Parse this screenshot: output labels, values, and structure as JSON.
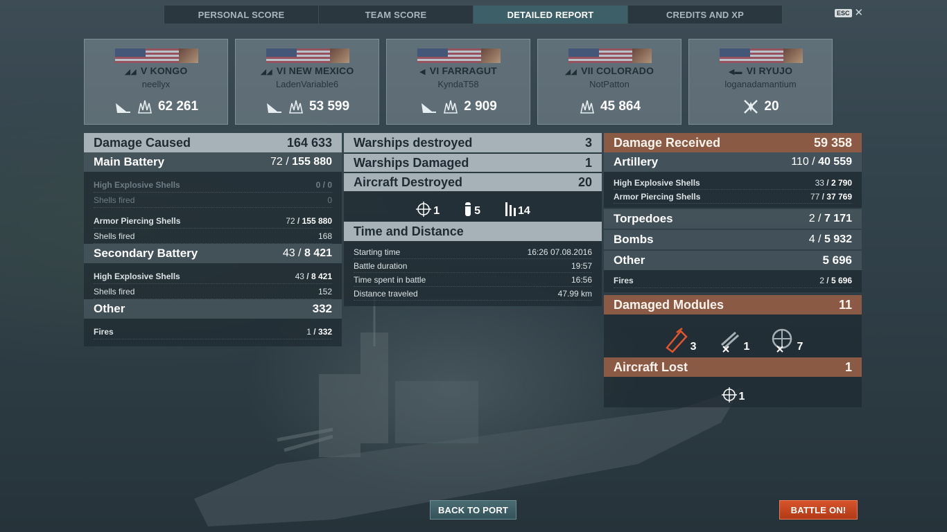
{
  "tabs": [
    "PERSONAL SCORE",
    "TEAM SCORE",
    "DETAILED REPORT",
    "CREDITS AND XP"
  ],
  "active_tab": "DETAILED REPORT",
  "esc_label": "ESC",
  "players": [
    {
      "tier": "V",
      "ship": "KONGO",
      "player": "neellyx",
      "score": "62 261",
      "icons": [
        "torpedo-hit-icon",
        "damage-burst-icon"
      ]
    },
    {
      "tier": "VI",
      "ship": "NEW MEXICO",
      "player": "LadenVariable6",
      "score": "53 599",
      "icons": [
        "torpedo-hit-icon",
        "damage-burst-icon"
      ]
    },
    {
      "tier": "VI",
      "ship": "FARRAGUT",
      "player": "KyndaT58",
      "score": "2 909",
      "icons": [
        "torpedo-hit-icon",
        "damage-burst-icon"
      ]
    },
    {
      "tier": "VII",
      "ship": "COLORADO",
      "player": "NotPatton",
      "score": "45 864",
      "icons": [
        "damage-burst-icon"
      ]
    },
    {
      "tier": "VI",
      "ship": "RYUJO",
      "player": "loganadamantium",
      "score": "20",
      "icons": [
        "plane-destroyed-icon"
      ]
    }
  ],
  "damage_caused": {
    "title": "Damage Caused",
    "total": "164 633",
    "main_battery": {
      "label": "Main Battery",
      "hits": "72",
      "value": "155 880",
      "rows": [
        {
          "label": "High Explosive Shells",
          "a": "0",
          "b": "0",
          "dim": true
        },
        {
          "label": "Shells fired",
          "a": "",
          "b": "0",
          "dim": true
        },
        {
          "label": "Armor Piercing Shells",
          "a": "72",
          "b": "155 880",
          "dim": false
        },
        {
          "label": "Shells fired",
          "a": "",
          "b": "168",
          "dim": false
        }
      ]
    },
    "secondary": {
      "label": "Secondary Battery",
      "hits": "43",
      "value": "8 421",
      "rows": [
        {
          "label": "High Explosive Shells",
          "a": "43",
          "b": "8 421"
        },
        {
          "label": "Shells fired",
          "a": "",
          "b": "152"
        }
      ]
    },
    "other": {
      "label": "Other",
      "value": "332",
      "rows": [
        {
          "label": "Fires",
          "a": "1",
          "b": "332"
        }
      ]
    }
  },
  "middle": {
    "warships_destroyed": {
      "label": "Warships destroyed",
      "value": "3"
    },
    "warships_damaged": {
      "label": "Warships Damaged",
      "value": "1"
    },
    "aircraft_destroyed": {
      "label": "Aircraft Destroyed",
      "value": "20"
    },
    "aircraft_types": [
      {
        "icon": "fighter-crosshair-icon",
        "count": "1"
      },
      {
        "icon": "bomber-icon",
        "count": "5"
      },
      {
        "icon": "torpedo-bomber-icon",
        "count": "14"
      }
    ],
    "time_title": "Time and Distance",
    "time_rows": [
      {
        "label": "Starting time",
        "value": "16:26  07.08.2016"
      },
      {
        "label": "Battle duration",
        "value": "19:57"
      },
      {
        "label": "Time spent in battle",
        "value": "16:56"
      },
      {
        "label": "Distance traveled",
        "value": "47.99 km"
      }
    ]
  },
  "damage_received": {
    "title": "Damage Received",
    "total": "59 358",
    "artillery": {
      "label": "Artillery",
      "hits": "110",
      "value": "40 559",
      "rows": [
        {
          "label": "High Explosive Shells",
          "a": "33",
          "b": "2 790"
        },
        {
          "label": "Armor Piercing Shells",
          "a": "77",
          "b": "37 769"
        }
      ]
    },
    "torpedoes": {
      "label": "Torpedoes",
      "hits": "2",
      "value": "7 171"
    },
    "bombs": {
      "label": "Bombs",
      "hits": "4",
      "value": "5 932"
    },
    "other": {
      "label": "Other",
      "value": "5 696",
      "rows": [
        {
          "label": "Fires",
          "a": "2",
          "b": "5 696"
        }
      ]
    },
    "modules": {
      "label": "Damaged Modules",
      "value": "11",
      "items": [
        {
          "icon": "engine-module-icon",
          "count": "3"
        },
        {
          "icon": "turret-module-icon",
          "count": "1"
        },
        {
          "icon": "aa-module-icon",
          "count": "7"
        }
      ]
    },
    "aircraft_lost": {
      "label": "Aircraft Lost",
      "value": "1",
      "items": [
        {
          "icon": "fighter-crosshair-icon",
          "count": "1"
        }
      ]
    }
  },
  "buttons": {
    "back": "BACK TO PORT",
    "battle": "BATTLE ON!"
  }
}
